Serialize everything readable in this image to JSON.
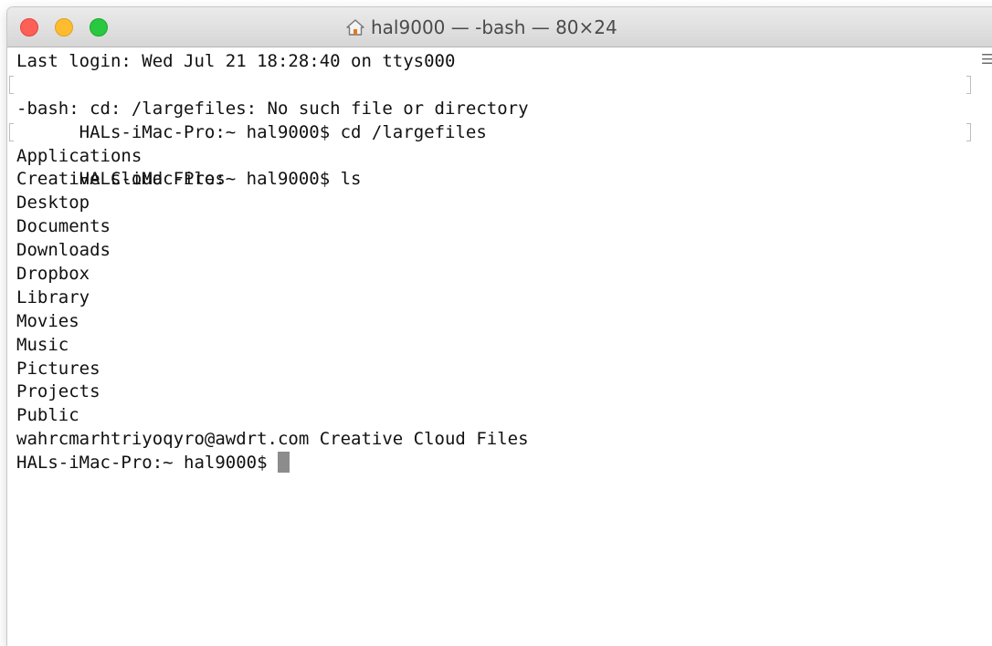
{
  "window": {
    "title": "hal9000 — -bash — 80×24",
    "title_icon": "home-icon",
    "traffic_lights": {
      "close_color": "#fe5f57",
      "minimize_color": "#febc2e",
      "zoom_color": "#28c840"
    }
  },
  "terminal": {
    "lines": [
      "Last login: Wed Jul 21 18:28:40 on ttys000",
      "HALs-iMac-Pro:~ hal9000$ cd /largefiles",
      "-bash: cd: /largefiles: No such file or directory",
      "HALs-iMac-Pro:~ hal9000$ ls",
      "Applications",
      "Creative Cloud Files",
      "Desktop",
      "Documents",
      "Downloads",
      "Dropbox",
      "Library",
      "Movies",
      "Music",
      "Pictures",
      "Projects",
      "Public",
      "wahrcmarhtriyoqyro@awdrt.com Creative Cloud Files"
    ],
    "current_prompt": "HALs-iMac-Pro:~ hal9000$ "
  },
  "scroll_marker_icon": "menu-lines-icon"
}
